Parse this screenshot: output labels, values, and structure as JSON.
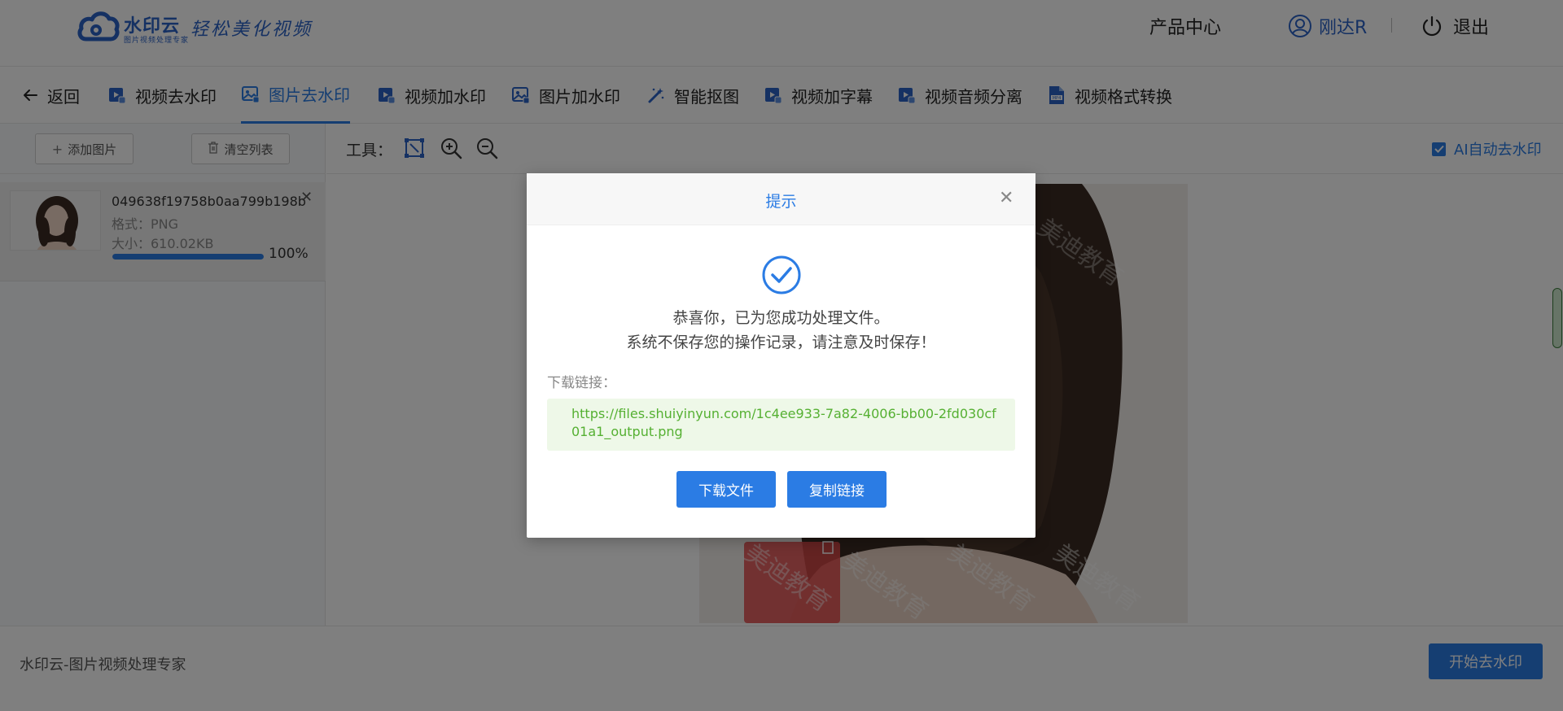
{
  "header": {
    "logo_name": "水印云",
    "logo_sub": "图片视频处理专家",
    "logo_slogan": "轻松美化视频",
    "product_center": "产品中心",
    "user_name": "刚达R",
    "logout": "退出"
  },
  "nav": {
    "back": "返回",
    "items": [
      {
        "label": "视频去水印",
        "icon": "video-icon"
      },
      {
        "label": "图片去水印",
        "icon": "image-icon",
        "active": true
      },
      {
        "label": "视频加水印",
        "icon": "video-icon"
      },
      {
        "label": "图片加水印",
        "icon": "image-icon"
      },
      {
        "label": "智能抠图",
        "icon": "magic-wand-icon"
      },
      {
        "label": "视频加字幕",
        "icon": "video-icon"
      },
      {
        "label": "视频音频分离",
        "icon": "video-icon"
      },
      {
        "label": "视频格式转换",
        "icon": "mp4-file-icon"
      }
    ]
  },
  "left_panel": {
    "add_image": "添加图片",
    "clear_list": "清空列表",
    "file": {
      "name": "049638f19758b0aa799b198b...",
      "format": "格式：PNG",
      "size": "大小：610.02KB",
      "progress": 1.0,
      "progress_text": "100%"
    }
  },
  "tools": {
    "label": "工具：",
    "ai_auto": "AI自动去水印",
    "ai_auto_checked": true
  },
  "canvas": {
    "watermark_text": "美迪教育"
  },
  "footer": {
    "text": "水印云-图片视频处理专家",
    "start_button": "开始去水印"
  },
  "dialog": {
    "title": "提示",
    "message_line1": "恭喜你，已为您成功处理文件。",
    "message_line2": "系统不保存您的操作记录，请注意及时保存！",
    "download_label": "下载链接：",
    "download_url": "https://files.shuiyinyun.com/1c4ee933-7a82-4006-bb00-2fd030cf01a1_output.png",
    "download_button": "下载文件",
    "copy_button": "复制链接"
  },
  "colors": {
    "accent": "#2b7ce4",
    "brand": "#2b62c6",
    "success_link": "#55b032",
    "overlay": "rgba(0,0,0,0.5)"
  }
}
